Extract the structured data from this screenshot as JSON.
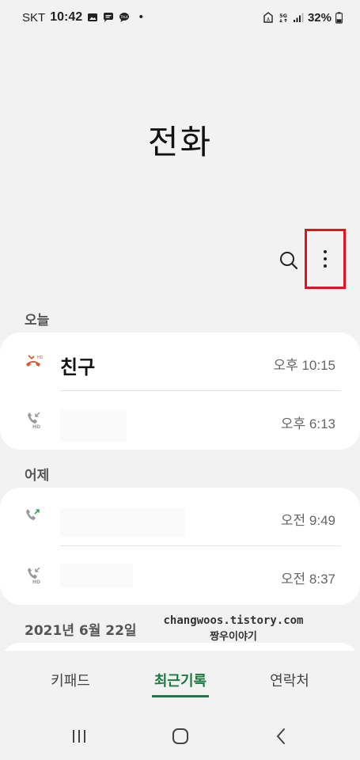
{
  "status_bar": {
    "carrier": "SKT",
    "time": "10:42",
    "dot": "•",
    "battery": "32%",
    "left_icons": [
      "gallery-icon",
      "message-icon",
      "talk-icon"
    ],
    "right_icons": [
      "alarm-icon",
      "5g-icon",
      "signal-icon",
      "battery-icon"
    ]
  },
  "header": {
    "title": "전화"
  },
  "toolbar": {
    "icons": [
      "search-icon",
      "more-options-icon"
    ],
    "highlight_color": "#e0141e"
  },
  "sections": [
    {
      "label": "오늘",
      "entries": [
        {
          "name": "친구",
          "time": "오후 10:15",
          "type": "missed",
          "icon": "missed-call-icon"
        },
        {
          "name": "",
          "time": "오후 6:13",
          "type": "incoming-hd",
          "icon": "incoming-hd-call-icon"
        }
      ]
    },
    {
      "label": "어제",
      "entries": [
        {
          "name": "",
          "time": "오전 9:49",
          "type": "outgoing",
          "icon": "outgoing-call-icon"
        },
        {
          "name": "",
          "time": "오전 8:37",
          "type": "incoming-hd",
          "icon": "incoming-hd-call-icon"
        }
      ]
    },
    {
      "label": "2021년 6월 22일",
      "entries": []
    }
  ],
  "watermark": {
    "line1": "changwoos.tistory.com",
    "line2": "짱우이야기"
  },
  "tabs": [
    {
      "label": "키패드",
      "active": false
    },
    {
      "label": "최근기록",
      "active": true
    },
    {
      "label": "연락처",
      "active": false
    }
  ],
  "colors": {
    "accent": "#1d7a42",
    "missed": "#d9552b",
    "outgoing": "#2fa84f",
    "background": "#f2f2f2"
  },
  "nav_bar": {
    "icons": [
      "recent-apps-icon",
      "home-icon",
      "back-icon"
    ]
  }
}
